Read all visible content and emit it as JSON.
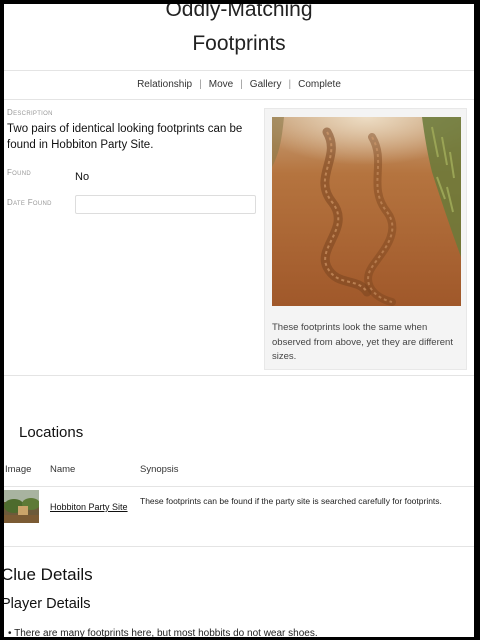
{
  "page": {
    "title_line1": "Oddly-Matching",
    "title_line2": "Footprints"
  },
  "nav": {
    "items": [
      "Relationship",
      "Move",
      "Gallery",
      "Complete"
    ],
    "separator": "|"
  },
  "details": {
    "description_label": "Description",
    "description": "Two pairs of identical looking footprints can be found in Hobbiton Party Site.",
    "found_label": "Found",
    "found_value": "No",
    "date_found_label": "Date Found",
    "date_found_value": ""
  },
  "image_card": {
    "image_icon": "footprints-photo",
    "caption": "These footprints look the same when observed from above, yet they are different sizes."
  },
  "locations": {
    "heading": "Locations",
    "columns": [
      "Image",
      "Name",
      "Synopsis"
    ],
    "rows": [
      {
        "thumbnail_icon": "hobbiton-thumbnail",
        "name": "Hobbiton Party Site",
        "synopsis": "These footprints can be found if the party site is searched carefully for footprints."
      }
    ]
  },
  "clue_details": {
    "heading": "Clue Details"
  },
  "player_details": {
    "heading": "Player Details",
    "bullets": [
      "There are many footprints here, but most hobbits do not wear shoes."
    ]
  }
}
